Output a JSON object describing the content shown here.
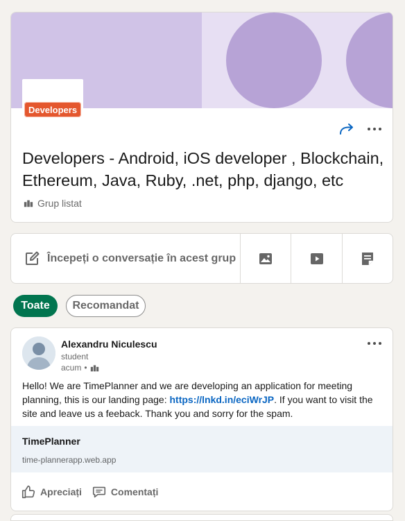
{
  "group": {
    "logo_text": "Developers",
    "title": "Developers - Android, iOS developer , Blockchain, Ethereum, Java, Ruby, .net, php, django, etc",
    "type": "Grup listat"
  },
  "composer": {
    "label": "Începeți o conversație în acest grup",
    "actions": [
      "image-icon",
      "video-icon",
      "article-icon"
    ]
  },
  "filters": {
    "all": "Toate",
    "recommended": "Recomandat"
  },
  "post": {
    "author": "Alexandru Niculescu",
    "headline": "student",
    "time": "acum",
    "separator": "•",
    "body_before": "Hello! We are TimePlanner and we are developing an application for meeting planning, this is our landing page: ",
    "link": "https://lnkd.in/eciWrJP",
    "body_after": ". If you want to visit the site and leave us a feeback. Thank you and sorry for the spam.",
    "preview": {
      "title": "TimePlanner",
      "url": "time-plannerapp.web.app"
    },
    "actions": {
      "like": "Apreciați",
      "comment": "Comentați"
    }
  },
  "colors": {
    "accent": "#01754f",
    "link": "#0a66c2",
    "cover": "#d0c3e7",
    "badge": "#e4572e"
  }
}
